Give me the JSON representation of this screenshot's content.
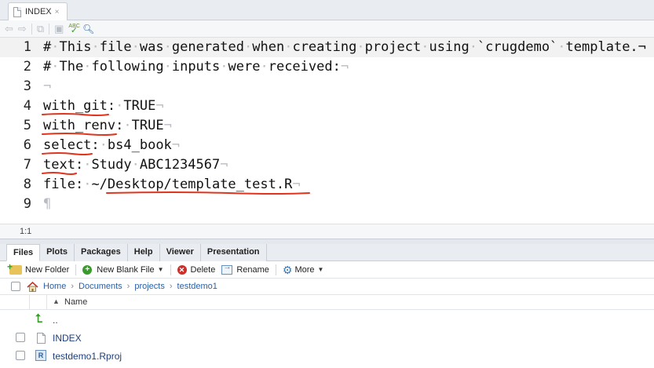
{
  "editor": {
    "tab": {
      "label": "INDEX",
      "close_glyph": "×"
    },
    "toolbar": {
      "spell_label": "ABC"
    },
    "lines": [
      {
        "num": "1",
        "segments": [
          {
            "t": "#"
          },
          {
            "t": "·",
            "ws": true
          },
          {
            "t": "This"
          },
          {
            "t": "·",
            "ws": true
          },
          {
            "t": "file"
          },
          {
            "t": "·",
            "ws": true
          },
          {
            "t": "was"
          },
          {
            "t": "·",
            "ws": true
          },
          {
            "t": "generated"
          },
          {
            "t": "·",
            "ws": true
          },
          {
            "t": "when"
          },
          {
            "t": "·",
            "ws": true
          },
          {
            "t": "creating"
          },
          {
            "t": "·",
            "ws": true
          },
          {
            "t": "project"
          },
          {
            "t": "·",
            "ws": true
          },
          {
            "t": "using"
          },
          {
            "t": "·",
            "ws": true
          },
          {
            "t": "`crugdemo`"
          },
          {
            "t": "·",
            "ws": true
          },
          {
            "t": "template.¬",
            "nl": true
          }
        ]
      },
      {
        "num": "2",
        "segments": [
          {
            "t": "#"
          },
          {
            "t": "·",
            "ws": true
          },
          {
            "t": "The"
          },
          {
            "t": "·",
            "ws": true
          },
          {
            "t": "following"
          },
          {
            "t": "·",
            "ws": true
          },
          {
            "t": "inputs"
          },
          {
            "t": "·",
            "ws": true
          },
          {
            "t": "were"
          },
          {
            "t": "·",
            "ws": true
          },
          {
            "t": "received:"
          },
          {
            "t": "¬",
            "ws": true
          }
        ]
      },
      {
        "num": "3",
        "segments": [
          {
            "t": "¬",
            "ws": true
          }
        ]
      },
      {
        "num": "4",
        "segments": [
          {
            "t": "with_git:"
          },
          {
            "t": "·",
            "ws": true
          },
          {
            "t": "TRUE"
          },
          {
            "t": "¬",
            "ws": true
          }
        ]
      },
      {
        "num": "5",
        "segments": [
          {
            "t": "with_renv:"
          },
          {
            "t": "·",
            "ws": true
          },
          {
            "t": "TRUE"
          },
          {
            "t": "¬",
            "ws": true
          }
        ]
      },
      {
        "num": "6",
        "segments": [
          {
            "t": "select:"
          },
          {
            "t": "·",
            "ws": true
          },
          {
            "t": "bs4_book"
          },
          {
            "t": "¬",
            "ws": true
          }
        ]
      },
      {
        "num": "7",
        "segments": [
          {
            "t": "text:"
          },
          {
            "t": "·",
            "ws": true
          },
          {
            "t": "Study"
          },
          {
            "t": "·",
            "ws": true
          },
          {
            "t": "ABC1234567"
          },
          {
            "t": "¬",
            "ws": true
          }
        ]
      },
      {
        "num": "8",
        "segments": [
          {
            "t": "file:"
          },
          {
            "t": "·",
            "ws": true
          },
          {
            "t": "~/Desktop/template_test.R"
          },
          {
            "t": "¬",
            "ws": true
          }
        ]
      },
      {
        "num": "9",
        "segments": [
          {
            "t": "¶",
            "ws": true
          }
        ]
      }
    ],
    "status": {
      "position": "1:1"
    }
  },
  "files_pane": {
    "tabs": [
      "Files",
      "Plots",
      "Packages",
      "Help",
      "Viewer",
      "Presentation"
    ],
    "active_tab": "Files",
    "toolbar": {
      "new_folder": "New Folder",
      "new_blank_file": "New Blank File",
      "delete": "Delete",
      "rename": "Rename",
      "more": "More"
    },
    "breadcrumb": [
      "Home",
      "Documents",
      "projects",
      "testdemo1"
    ],
    "column_header": "Name",
    "rows": [
      {
        "name": "..",
        "icon": "up-arrow-icon"
      },
      {
        "name": "INDEX",
        "icon": "file-icon"
      },
      {
        "name": "testdemo1.Rproj",
        "icon": "rproj-icon",
        "icon_letter": "R"
      }
    ]
  },
  "colors": {
    "annotation_red": "#e0341c",
    "link_blue": "#2b5fa4"
  }
}
